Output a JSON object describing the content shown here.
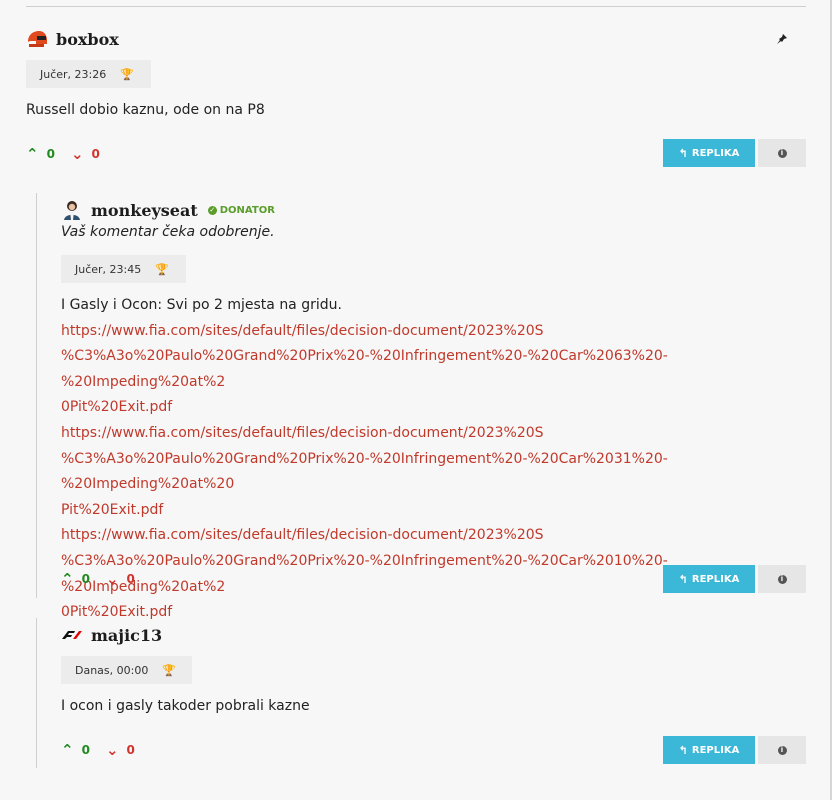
{
  "posts": [
    {
      "username": "boxbox",
      "avatar_icon": "racing-helmet-icon",
      "timestamp": "Jučer, 23:26",
      "body": "Russell dobio kaznu, ode on na P8",
      "upvotes": "0",
      "downvotes": "0",
      "reply_label": "REPLIKA"
    },
    {
      "username": "monkeyseat",
      "avatar_icon": "person-avatar-icon",
      "badge": "DONATOR",
      "pending": "Vaš komentar čeka odobrenje.",
      "timestamp": "Jučer, 23:45",
      "body": "I Gasly i Ocon: Svi po 2 mjesta na gridu.",
      "links": [
        [
          "https://www.fia.com/sites/default/files/decision-document/2023%20S",
          "%C3%A3o%20Paulo%20Grand%20Prix%20-%20Infringement%20-%20Car%2063%20-%20Impeding%20at%2",
          "0Pit%20Exit.pdf"
        ],
        [
          "https://www.fia.com/sites/default/files/decision-document/2023%20S",
          "%C3%A3o%20Paulo%20Grand%20Prix%20-%20Infringement%20-%20Car%2031%20-%20Impeding%20at%20",
          "Pit%20Exit.pdf"
        ],
        [
          "https://www.fia.com/sites/default/files/decision-document/2023%20S",
          "%C3%A3o%20Paulo%20Grand%20Prix%20-%20Infringement%20-%20Car%2010%20-%20Impeding%20at%2",
          "0Pit%20Exit.pdf"
        ]
      ],
      "upvotes": "0",
      "downvotes": "0",
      "reply_label": "REPLIKA"
    },
    {
      "username": "majic13",
      "avatar_icon": "f1-logo-icon",
      "timestamp": "Danas, 00:00",
      "body": "I ocon i gasly takoder pobrali kazne",
      "upvotes": "0",
      "downvotes": "0",
      "reply_label": "REPLIKA"
    }
  ],
  "icons": {
    "up": "chevron-up-icon",
    "down": "chevron-down-icon",
    "reply": "reply-arrow-icon",
    "info": "info-icon",
    "trophy": "trophy-icon",
    "pin": "pin-icon"
  },
  "colors": {
    "accent": "#3bb7d8",
    "upvote": "#1f8a1f",
    "downvote": "#d0342c",
    "link": "#c0392b",
    "donator": "#5a9d2a"
  }
}
